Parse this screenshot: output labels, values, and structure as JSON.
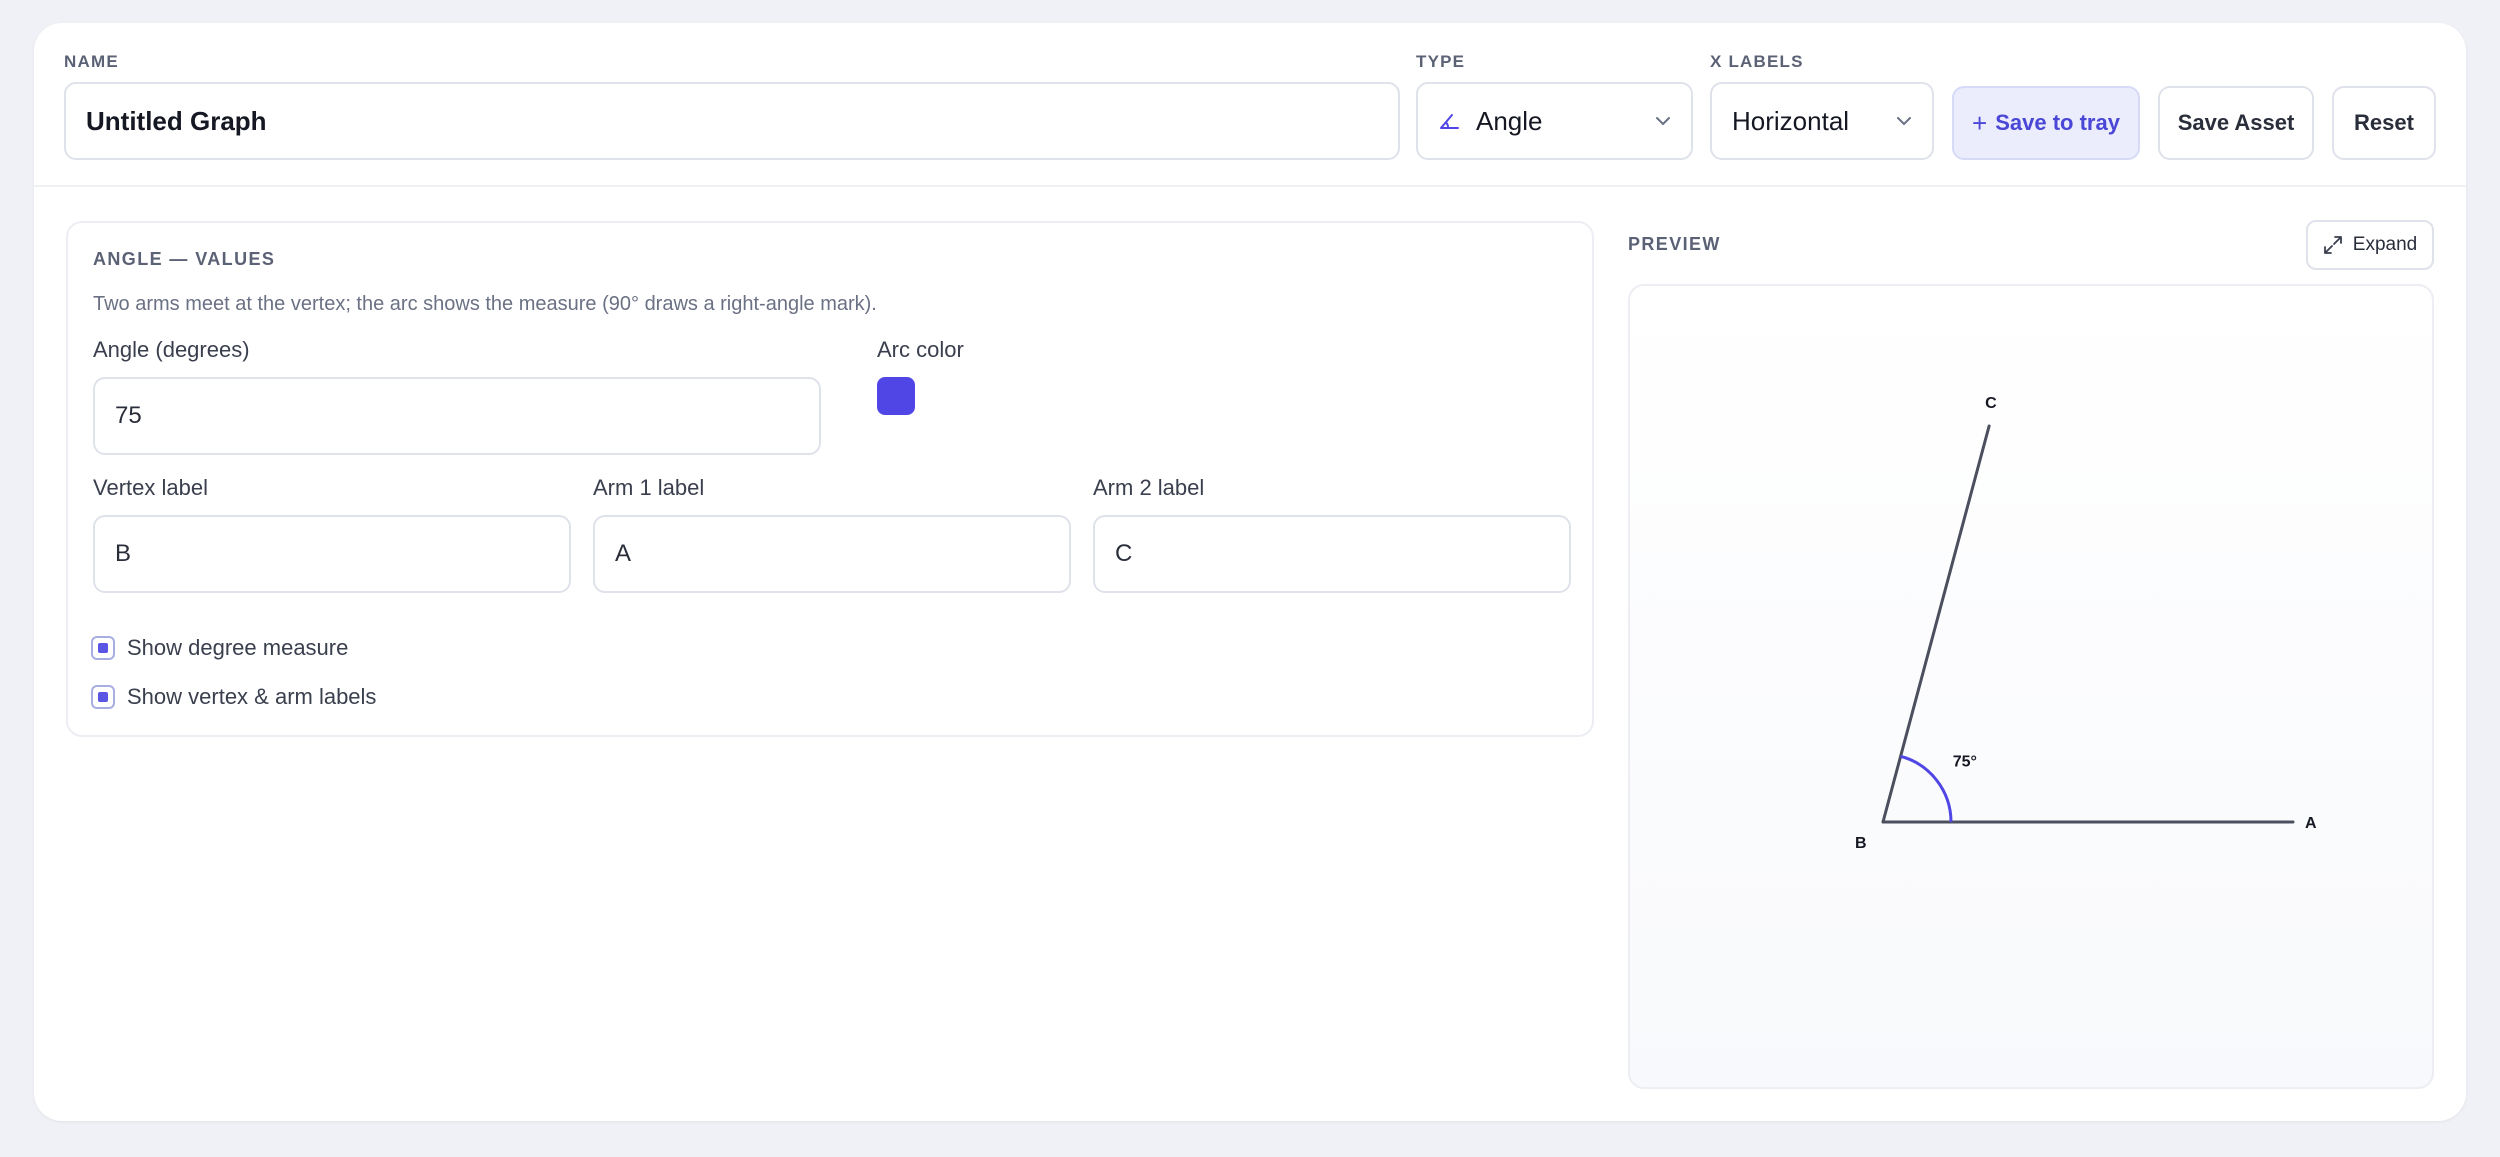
{
  "header": {
    "name_label": "NAME",
    "name_value": "Untitled Graph",
    "type_label": "TYPE",
    "type_value": "Angle",
    "type_icon": "angle-icon",
    "xlabels_label": "X LABELS",
    "xlabels_value": "Horizontal",
    "save_tray_label": "Save to tray",
    "save_asset_label": "Save Asset",
    "reset_label": "Reset"
  },
  "panel": {
    "title": "ANGLE — VALUES",
    "description": "Two arms meet at the vertex; the arc shows the measure (90° draws a right-angle mark).",
    "angle_label": "Angle (degrees)",
    "angle_value": "75",
    "arc_color_label": "Arc color",
    "arc_color": "#5046e5",
    "vertex_label": "Vertex label",
    "vertex_value": "B",
    "arm1_label": "Arm 1 label",
    "arm1_value": "A",
    "arm2_label": "Arm 2 label",
    "arm2_value": "C",
    "show_degree_label": "Show degree measure",
    "show_degree_checked": true,
    "show_labels_label": "Show vertex & arm labels",
    "show_labels_checked": true
  },
  "preview": {
    "title": "PREVIEW",
    "expand_label": "Expand",
    "angle_degrees": 75,
    "degree_text": "75°",
    "vertex": "B",
    "arm1": "A",
    "arm2": "C",
    "arm_color": "#4b4f5e",
    "arc_color": "#5046e5"
  }
}
